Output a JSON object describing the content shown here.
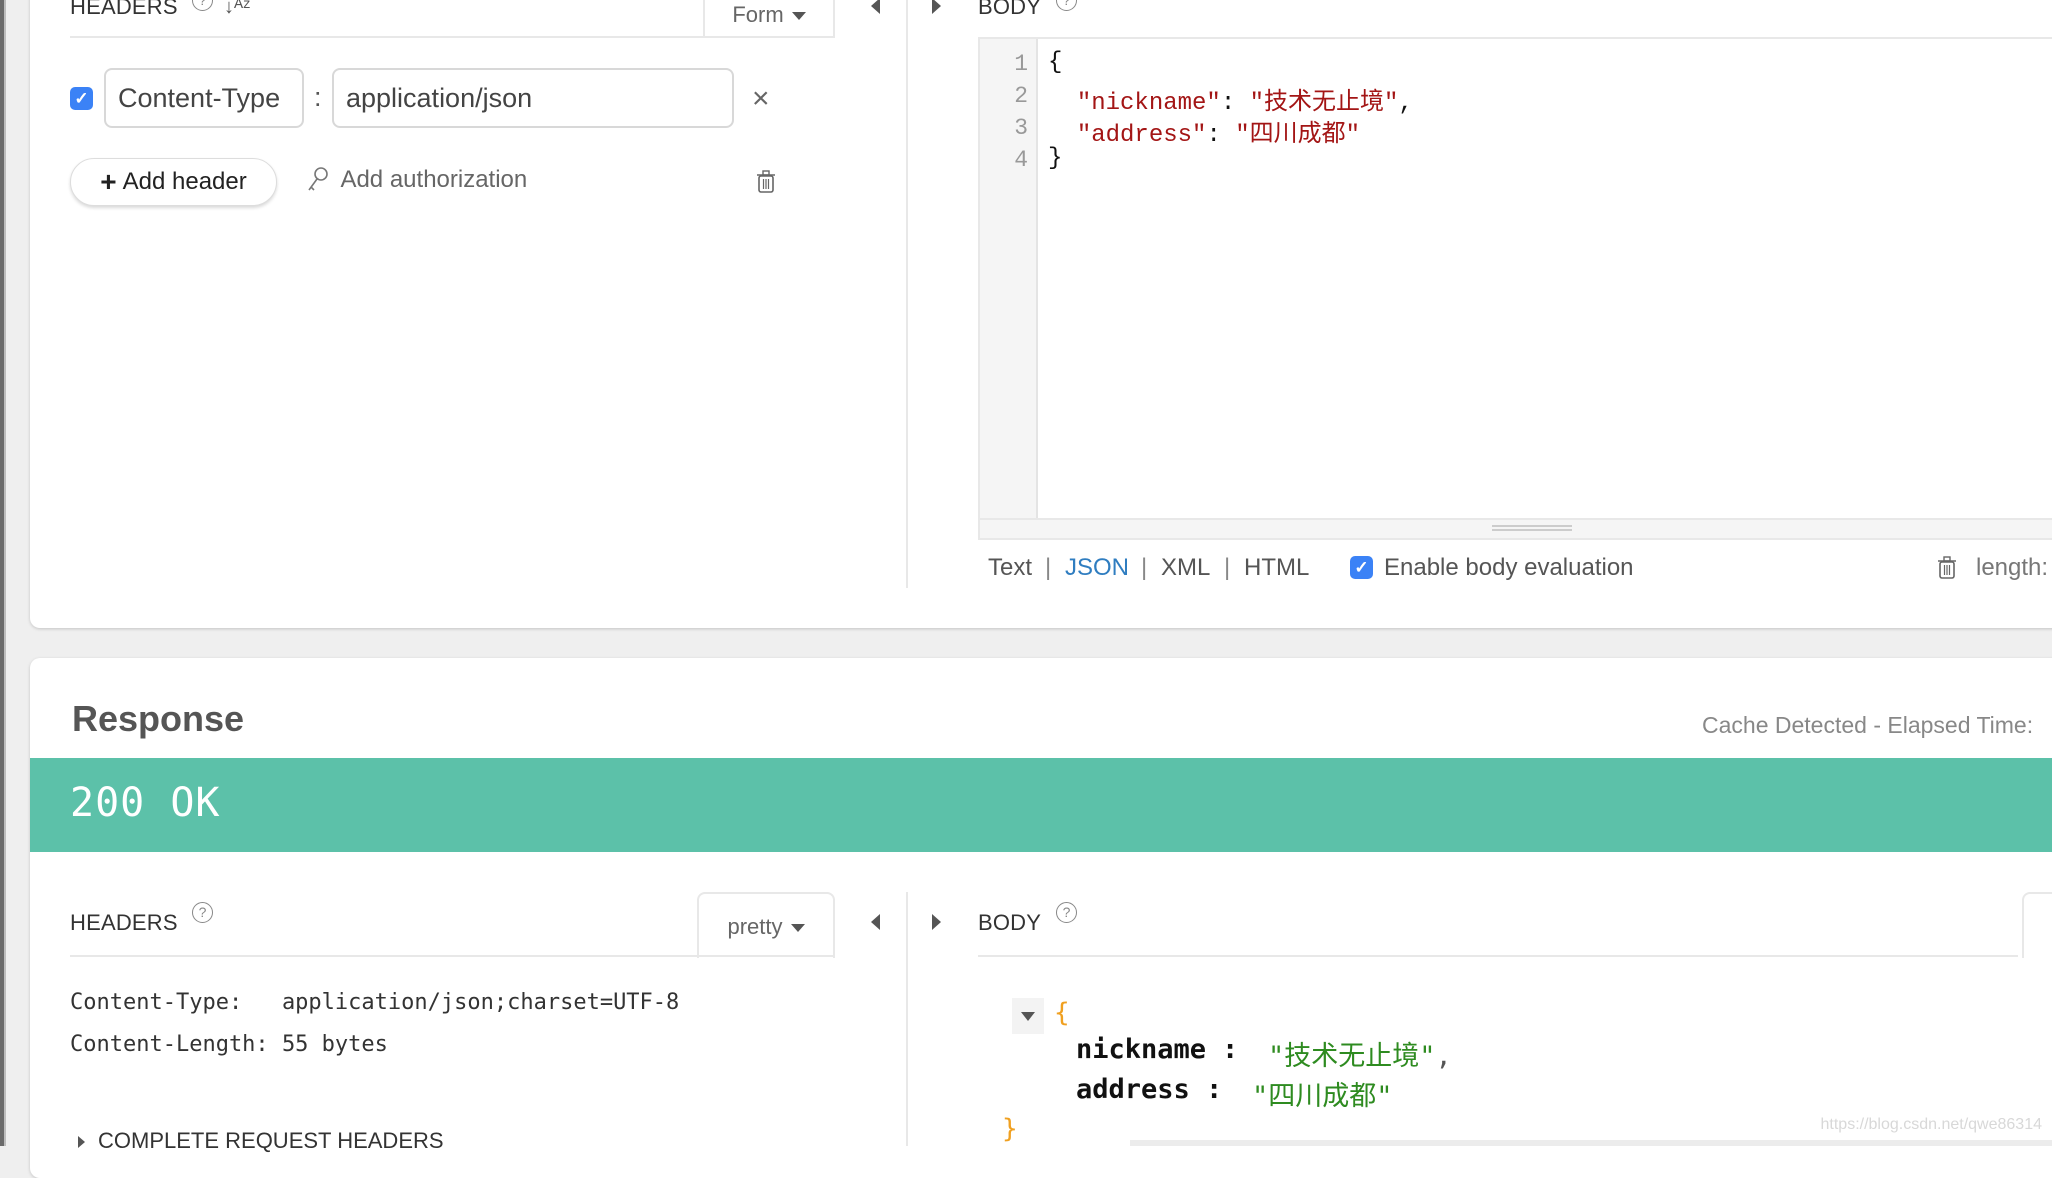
{
  "request": {
    "headers_label": "HEADERS",
    "help_icon": "?",
    "sort_icon": "sort-alpha-icon",
    "sort_glyph": "↓ᴬᶻ",
    "mode_dropdown": "Form",
    "header_rows": [
      {
        "enabled": true,
        "name": "Content-Type",
        "separator": ":",
        "value": "application/json"
      }
    ],
    "remove_glyph": "×",
    "add_header_label": "Add header",
    "add_header_glyph": "+",
    "add_authorization_label": "Add authorization",
    "body_label": "BODY",
    "body_line_numbers": [
      "1",
      "2",
      "3",
      "4"
    ],
    "body_lines": [
      {
        "indent": "",
        "key": "",
        "sep": "",
        "value": "",
        "plain": "{"
      },
      {
        "indent": "  ",
        "key": "\"nickname\"",
        "sep": ": ",
        "value": "\"技术无止境\"",
        "plain": ","
      },
      {
        "indent": "  ",
        "key": "\"address\"",
        "sep": ": ",
        "value": "\"四川成都\"",
        "plain": ""
      },
      {
        "indent": "",
        "key": "",
        "sep": "",
        "value": "",
        "plain": "}"
      }
    ],
    "body_formats": [
      "Text",
      "JSON",
      "XML",
      "HTML"
    ],
    "body_format_active": "JSON",
    "format_separator": "|",
    "enable_body_evaluation": {
      "checked": true,
      "label": "Enable body evaluation"
    },
    "length_label": "length:"
  },
  "response": {
    "title": "Response",
    "cache_info": "Cache Detected - Elapsed Time:",
    "status": "200 OK",
    "status_color": "#5cc1a9",
    "headers_label": "HEADERS",
    "headers_view": "pretty",
    "headers": [
      {
        "name": "Content-Type:",
        "value": "application/json;charset=UTF-8"
      },
      {
        "name": "Content-Length:",
        "value": "55 bytes"
      }
    ],
    "complete_request_headers_label": "COMPLETE REQUEST HEADERS",
    "body_label": "BODY",
    "body_tree": {
      "open_brace": "{",
      "close_brace": "}",
      "entries": [
        {
          "key": "nickname",
          "colon": " : ",
          "value": "\"技术无止境\"",
          "trail": ","
        },
        {
          "key": "address",
          "colon": " : ",
          "value": "\"四川成都\"",
          "trail": ""
        }
      ]
    },
    "watermark": "https://blog.csdn.net/qwe86314"
  }
}
